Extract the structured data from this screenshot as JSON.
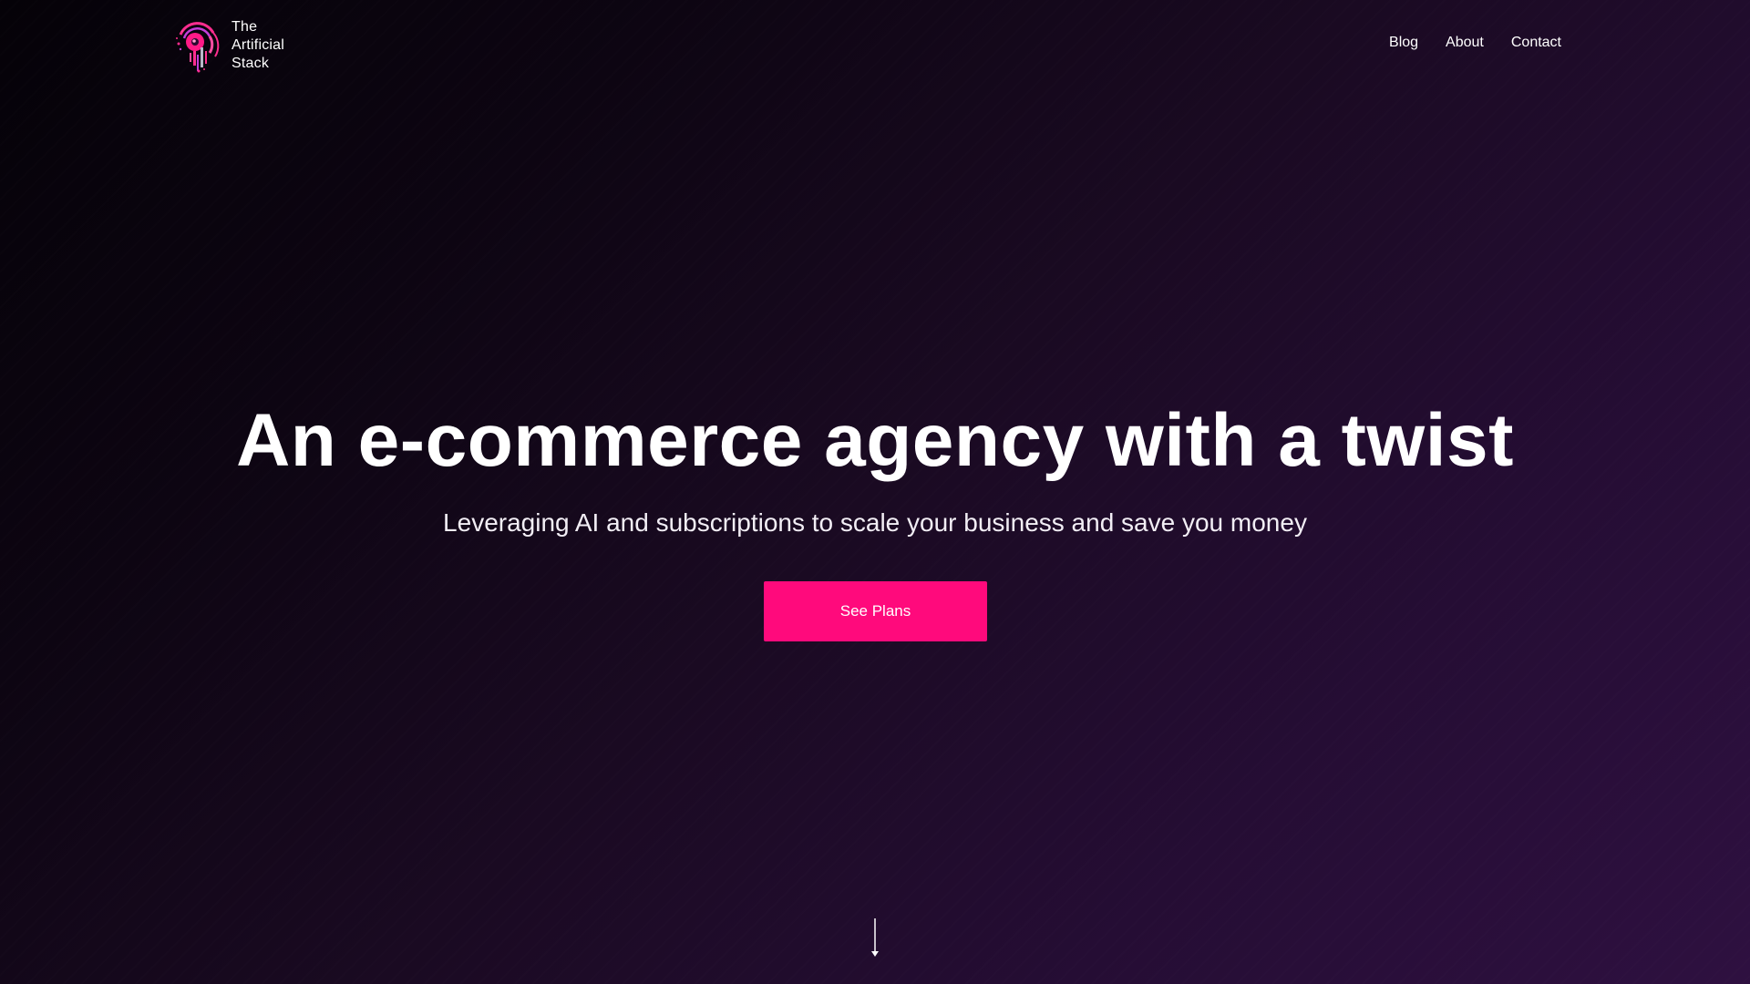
{
  "brand": {
    "name_line1": "The",
    "name_line2": "Artificial",
    "name_line3": "Stack",
    "logo_icon": "brand-logo-icon"
  },
  "nav": {
    "items": [
      {
        "label": "Blog"
      },
      {
        "label": "About"
      },
      {
        "label": "Contact"
      }
    ]
  },
  "hero": {
    "headline": "An e-commerce agency with a twist",
    "subheadline": "Leveraging AI and subscriptions to scale your business and save you money",
    "cta_label": "See Plans",
    "scroll_icon": "arrow-down-icon"
  },
  "colors": {
    "accent": "#ff0a7c",
    "background_start": "#050208",
    "background_end": "#2e1040",
    "text": "#ffffff"
  }
}
